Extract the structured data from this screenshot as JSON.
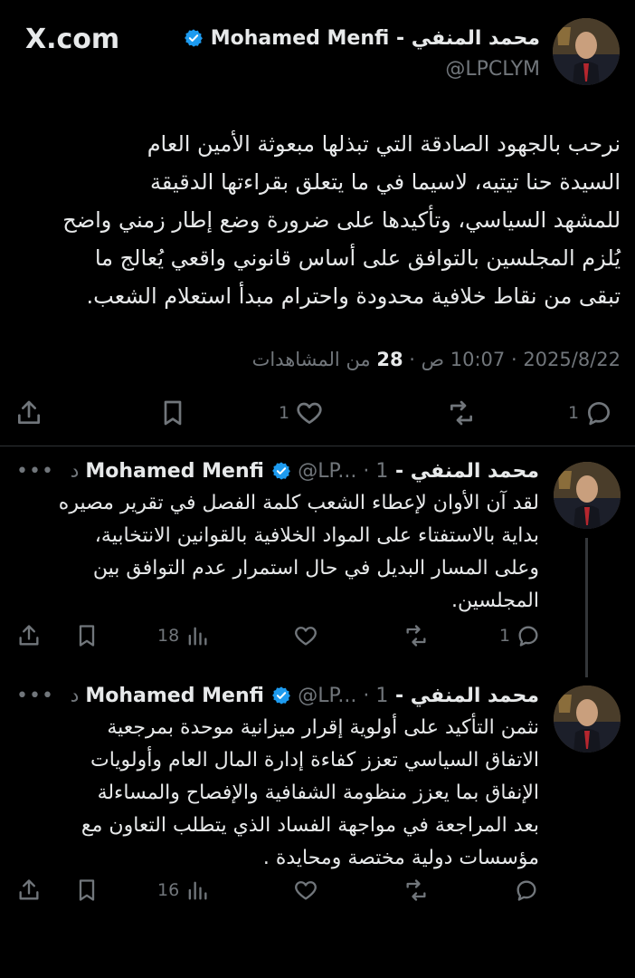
{
  "brand": {
    "site": "X.com"
  },
  "main_tweet": {
    "author_name": "محمد المنفي - Mohamed Menfi",
    "author_handle": "@LPCLYM",
    "text_lines": [
      "نرحب بالجهود الصادقة التي تبذلها مبعوثة الأمين العام",
      "السيدة حنا تيتيه، لاسيما في ما يتعلق بقراءتها الدقيقة",
      "للمشهد السياسي، وتأكيدها على ضرورة وضع إطار زمني واضح",
      "يُلزم المجلسين بالتوافق على أساس قانوني واقعي يُعالج ما",
      "تبقى من نقاط خلافية محدودة واحترام مبدأ استعلام الشعب."
    ],
    "date": "2025/8/22",
    "time": "10:07 ص",
    "views_count": "28",
    "views_label": "من المشاهدات",
    "reply_count": "1",
    "like_count": "1"
  },
  "replies": [
    {
      "author_name": "محمد المنفي - Mohamed Menfi",
      "handle_time": "@LP... · 1 د",
      "text_lines": [
        "لقد آن الأوان لإعطاء الشعب كلمة الفصل في تقرير مصيره",
        "بداية بالاستفتاء على المواد الخلافية بالقوانين الانتخابية،",
        "وعلى المسار البديل في حال استمرار عدم التوافق بين",
        "المجلسين."
      ],
      "reply_count": "1",
      "views_count": "18"
    },
    {
      "author_name": "محمد المنفي - Mohamed Menfi",
      "handle_time": "@LP... · 1 د",
      "text_lines": [
        "نثمن التأكيد على أولوية إقرار ميزانية موحدة بمرجعية",
        "الاتفاق السياسي تعزز كفاءة إدارة المال العام وأولويات",
        "الإنفاق بما يعزز منظومة الشفافية والإفصاح والمساءلة",
        "بعد المراجعة في مواجهة الفساد الذي يتطلب التعاون مع",
        "مؤسسات دولية مختصة ومحايدة ."
      ],
      "views_count": "16"
    }
  ],
  "colors": {
    "background": "#000000",
    "text": "#e7e9ea",
    "muted": "#71767b",
    "verified": "#1d9bf0",
    "divider": "#2f3336"
  },
  "icons": [
    "x-logo-icon",
    "verified-icon",
    "share-icon",
    "bookmark-icon",
    "like-icon",
    "repost-icon",
    "reply-icon",
    "views-icon",
    "more-icon"
  ]
}
